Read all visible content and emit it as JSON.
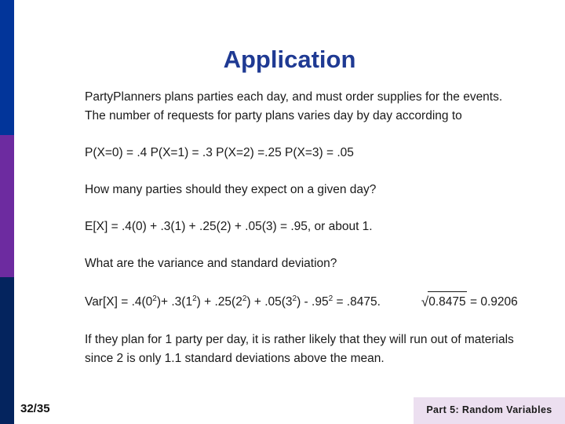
{
  "colors": {
    "sidebar_top": "#02359a",
    "sidebar_mid": "#6d2ba0",
    "sidebar_bottom": "#04245e",
    "title": "#1f3a93",
    "footer_band": "#ecdff0",
    "body_text": "#1a1a1a"
  },
  "title": "Application",
  "body": {
    "intro_line1": "PartyPlanners plans parties each day, and must order supplies for the events.",
    "intro_line2": "The number of requests for party plans varies day by day according to",
    "distribution": "P(X=0) = .4  P(X=1) = .3   P(X=2) =.25  P(X=3) = .05",
    "question_expected": "How many parties should they expect on a given day?",
    "expected_value": "E[X] = .4(0) + .3(1) + .25(2) + .05(3) = .95, or about 1.",
    "question_variance": "What are the variance and standard deviation?",
    "variance": {
      "lead": "Var[X] = .4(0",
      "sup1": "2",
      "mid1": ")+ .3(1",
      "sup2": "2",
      "mid2": ") + .25(2",
      "sup3": "2",
      "mid3": ") + .05(3",
      "sup4": "2",
      "mid4": ") - .95",
      "sup5": "2",
      "tail": " = .8475."
    },
    "sqrt": {
      "sign": "√",
      "radicand": "0.8475",
      "result": " = 0.9206"
    },
    "conclusion_line1": "If they plan for 1 party per day,  it is rather likely that they will run out of materials",
    "conclusion_line2": "since 2 is only 1.1 standard deviations above the mean."
  },
  "footer": {
    "page_number": "32/35",
    "section_label": "Part 5: Random Variables"
  }
}
